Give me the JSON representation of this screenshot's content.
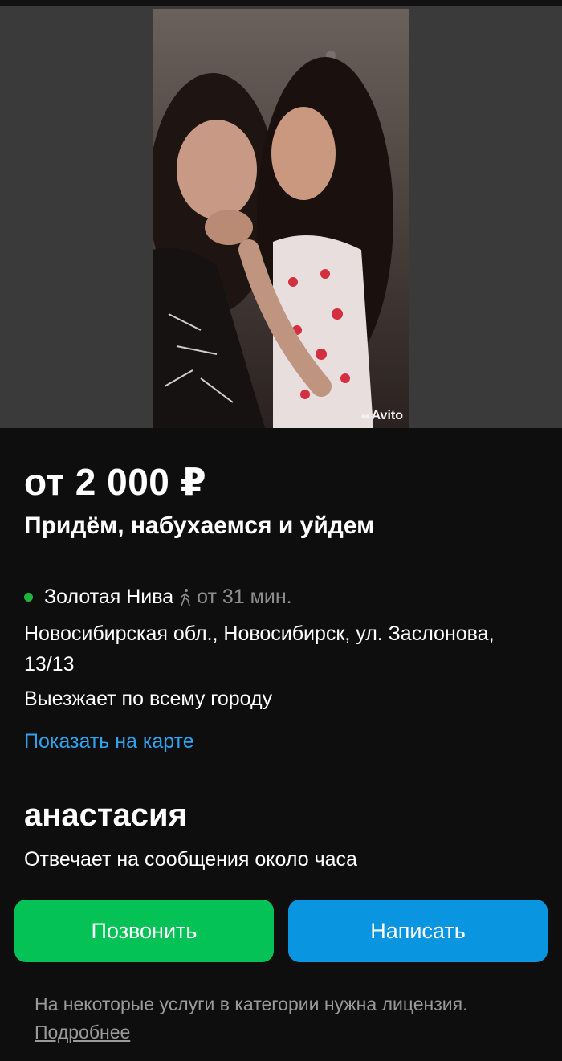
{
  "listing": {
    "watermark": "Avito",
    "price": "от 2 000 ₽",
    "title": "Придём, набухаемся и уйдем",
    "location": {
      "metro_name": "Золотая Нива",
      "metro_color": "#1eb53a",
      "metro_time": "от 31 мин.",
      "address": "Новосибирская обл., Новосибирск, ул. Заслонова, 13/13",
      "travel_note": "Выезжает по всему городу",
      "map_link": "Показать на карте"
    }
  },
  "seller": {
    "name": "анастасия",
    "reply_time": "Отвечает на сообщения около часа"
  },
  "actions": {
    "call_label": "Позвонить",
    "call_color": "#05c256",
    "write_label": "Написать",
    "write_color": "#0a95e0"
  },
  "footer": {
    "license_text": "На некоторые услуги в категории нужна лицензия.",
    "more_link": "Подробнее"
  }
}
